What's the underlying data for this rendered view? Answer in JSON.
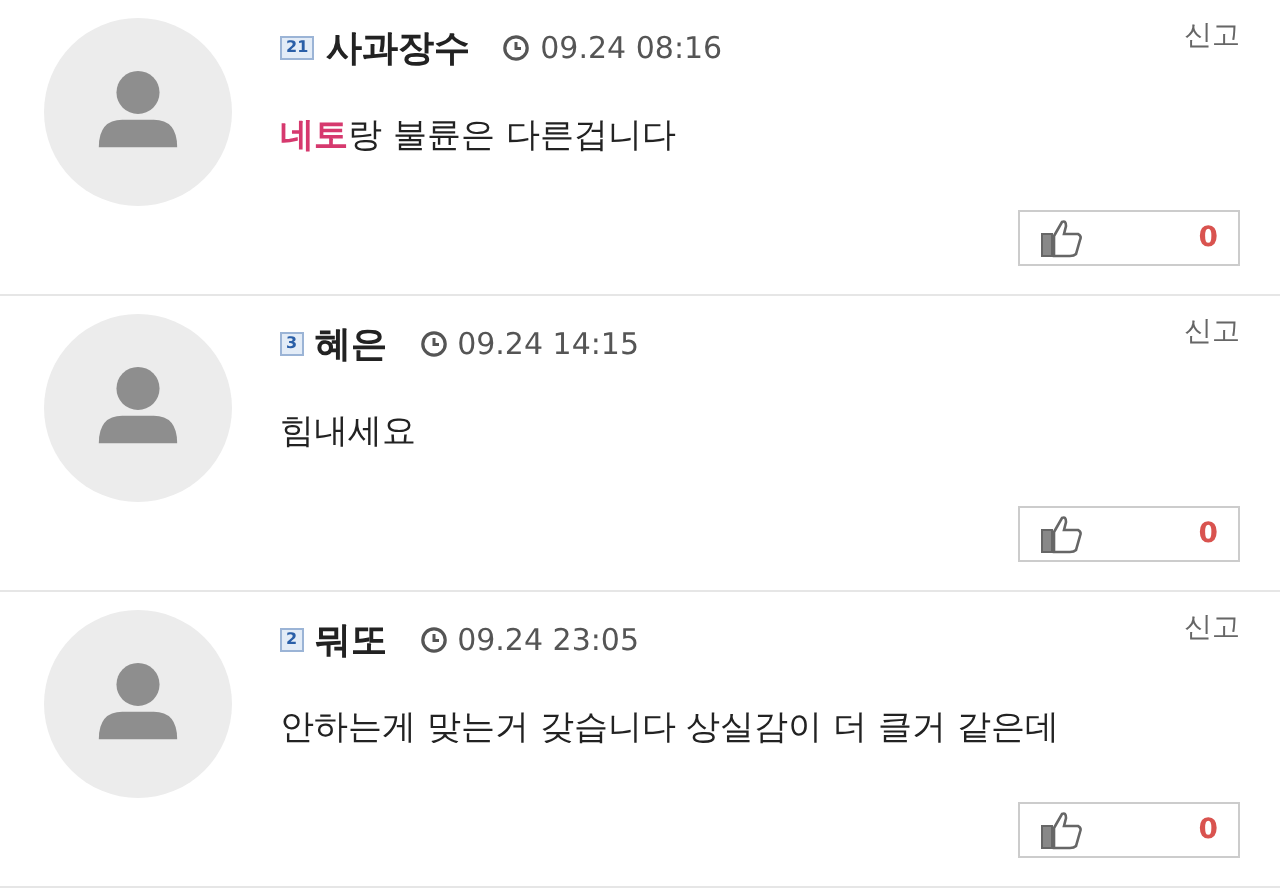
{
  "comments": [
    {
      "level": "21",
      "author": "사과장수",
      "time": "09.24 08:16",
      "report": "신고",
      "body": [
        {
          "text": "네토",
          "highlight": true
        },
        {
          "text": "랑 불륜은 다른겁니다",
          "highlight": false
        }
      ],
      "likes": "0"
    },
    {
      "level": "3",
      "author": "혜은",
      "time": "09.24 14:15",
      "report": "신고",
      "body": [
        {
          "text": "힘내세요",
          "highlight": false
        }
      ],
      "likes": "0"
    },
    {
      "level": "2",
      "author": "뭐또",
      "time": "09.24 23:05",
      "report": "신고",
      "body": [
        {
          "text": "안하는게 맞는거 갖습니다 상실감이  더 클거 같은데",
          "highlight": false
        }
      ],
      "likes": "0"
    }
  ]
}
